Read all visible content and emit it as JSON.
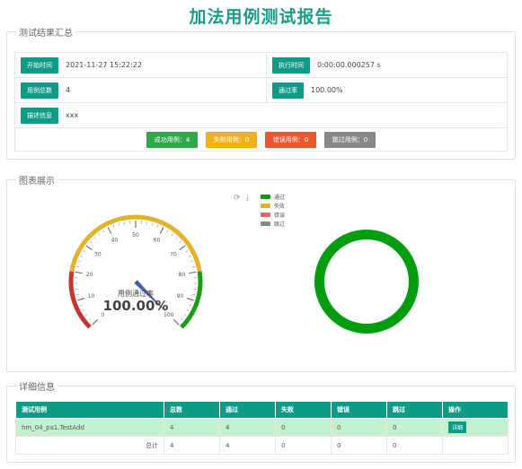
{
  "title": "加法用例测试报告",
  "summary": {
    "legend": "测试结果汇总",
    "start_label": "开始时间",
    "start_value": "2021-11-27 15:22:22",
    "exec_label": "执行时间",
    "exec_value": "0:00:00.000257 s",
    "total_label": "用例总数",
    "total_value": "4",
    "rate_label": "通过率",
    "rate_value": "100.00%",
    "desc_label": "描述信息",
    "desc_value": "xxx",
    "badges": {
      "pass": "成功用例：4",
      "fail": "失败用例：0",
      "error": "错误用例：0",
      "skip": "跳过用例：0"
    }
  },
  "charts": {
    "legend": "图表展示",
    "gauge_name": "用例通过率",
    "gauge_value_text": "100.00%",
    "icons": [
      "refresh-icon",
      "download-icon"
    ],
    "legend_items": [
      {
        "label": "通过",
        "color": "#009e0f"
      },
      {
        "label": "失败",
        "color": "#e0b320"
      },
      {
        "label": "错误",
        "color": "#e06666"
      },
      {
        "label": "跳过",
        "color": "#888888"
      }
    ]
  },
  "chart_data": [
    {
      "type": "gauge",
      "value": 100,
      "min": 0,
      "max": 100,
      "ticks": [
        "0",
        "10",
        "20",
        "30",
        "40",
        "50",
        "60",
        "70",
        "80",
        "90",
        "100"
      ],
      "title": "用例通过率"
    },
    {
      "type": "pie",
      "categories": [
        "通过",
        "失败",
        "错误",
        "跳过"
      ],
      "values": [
        4,
        0,
        0,
        0
      ]
    }
  ],
  "details": {
    "legend": "详细信息",
    "headers": [
      "测试用例",
      "总数",
      "通过",
      "失败",
      "错误",
      "跳过",
      "操作"
    ],
    "rows": [
      {
        "name": "hm_04_pa1.TestAdd",
        "total": "4",
        "pass": "4",
        "fail": "0",
        "error": "0",
        "skip": "0",
        "action": "详细"
      }
    ],
    "total_row": {
      "label": "总计",
      "total": "4",
      "pass": "4",
      "fail": "0",
      "error": "0",
      "skip": "0"
    }
  },
  "colors": {
    "accent": "#0f9b86",
    "pass": "#2ea84a",
    "fail": "#f0b01a",
    "error": "#e9582a",
    "skip": "#888888"
  }
}
